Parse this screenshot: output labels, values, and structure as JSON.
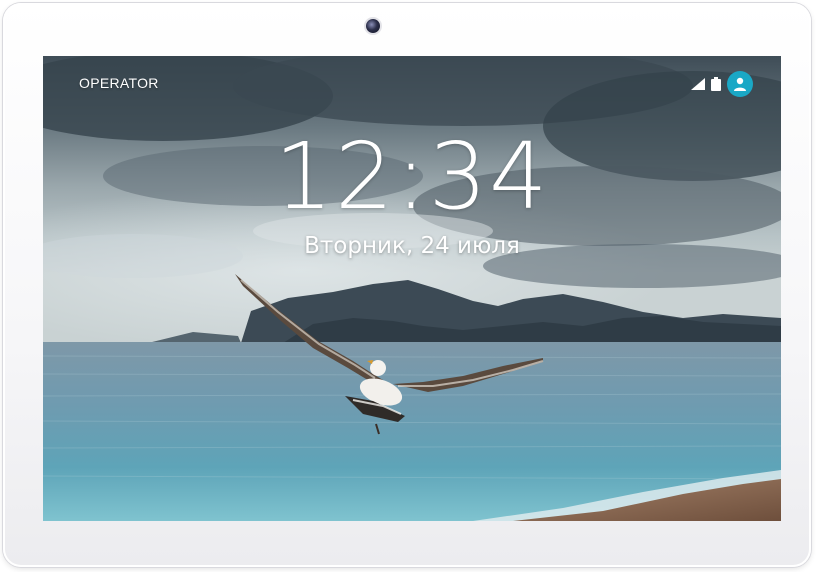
{
  "status_bar": {
    "operator": "OPERATOR",
    "signal_icon": "signal-icon",
    "battery_icon": "battery-icon",
    "user_icon": "user-avatar-icon"
  },
  "lock_screen": {
    "time": "12:34",
    "date": "Вторник, 24 июля"
  },
  "wallpaper": {
    "subject": "seagull-over-sea-icon"
  },
  "colors": {
    "avatar": "#1aa8c6",
    "frame": "#f4f4f6"
  }
}
